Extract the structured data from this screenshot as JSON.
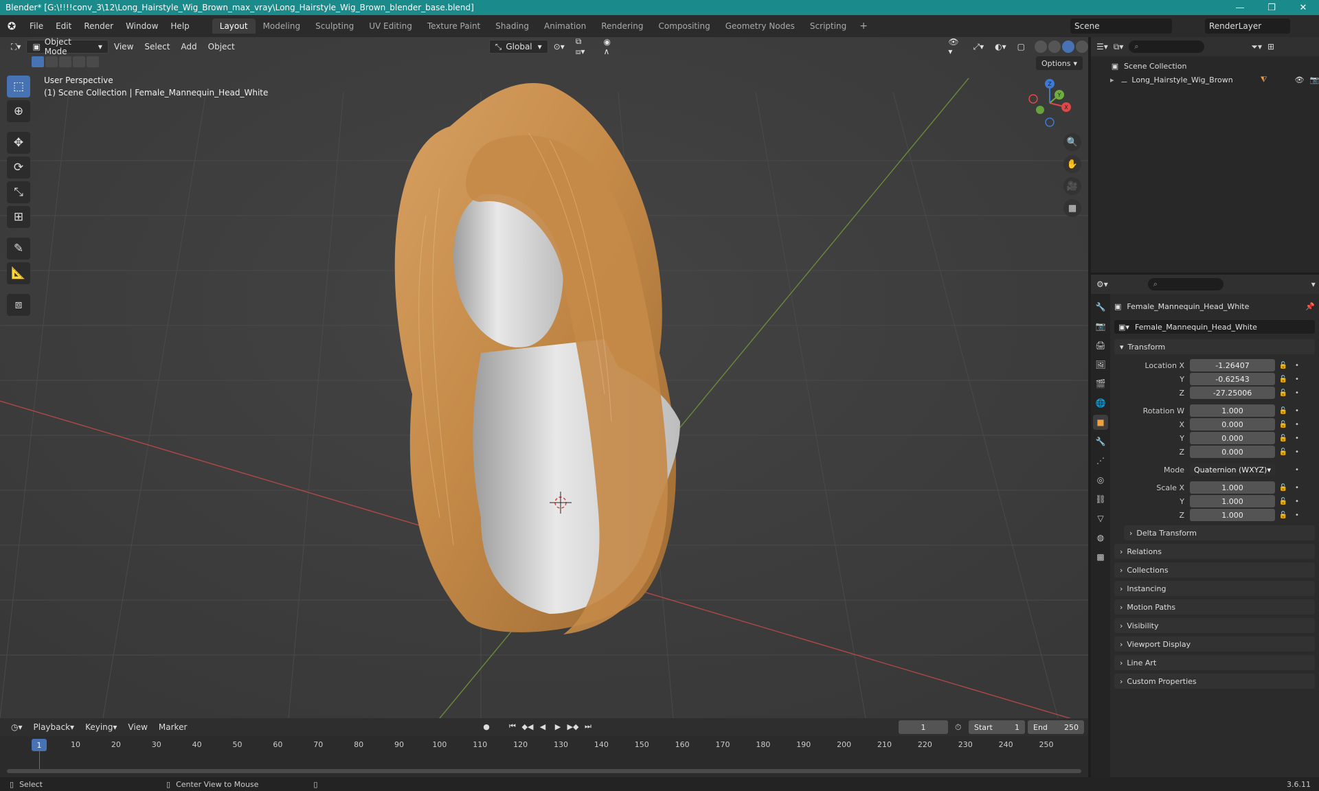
{
  "window": {
    "title": "Blender* [G:\\!!!!conv_3\\12\\Long_Hairstyle_Wig_Brown_max_vray\\Long_Hairstyle_Wig_Brown_blender_base.blend]",
    "minimize": "—",
    "maximize": "❐",
    "close": "✕"
  },
  "menubar": {
    "items": [
      "File",
      "Edit",
      "Render",
      "Window",
      "Help"
    ],
    "workspaces": [
      "Layout",
      "Modeling",
      "Sculpting",
      "UV Editing",
      "Texture Paint",
      "Shading",
      "Animation",
      "Rendering",
      "Compositing",
      "Geometry Nodes",
      "Scripting"
    ],
    "active_workspace": "Layout",
    "add_workspace": "+",
    "scene": "Scene",
    "view_layer": "RenderLayer"
  },
  "viewport": {
    "mode": "Object Mode",
    "menus": [
      "View",
      "Select",
      "Add",
      "Object"
    ],
    "transform_orientation": "Global",
    "options_label": "Options",
    "perspective_label": "User Perspective",
    "collection_label": "(1) Scene Collection | Female_Mannequin_Head_White",
    "gizmo_axes": [
      "X",
      "Y",
      "Z"
    ]
  },
  "outliner": {
    "search_placeholder": "",
    "root": "Scene Collection",
    "items": [
      {
        "label": "Long_Hairstyle_Wig_Brown"
      }
    ]
  },
  "properties": {
    "object_name": "Female_Mannequin_Head_White",
    "object_field": "Female_Mannequin_Head_White",
    "transform_title": "Transform",
    "location": {
      "label": "Location X",
      "x": "-1.26407",
      "y": "-0.62543",
      "z": "-27.25006"
    },
    "rotation": {
      "label": "Rotation W",
      "w": "1.000",
      "x": "0.000",
      "y": "0.000",
      "z": "0.000"
    },
    "mode": {
      "label": "Mode",
      "value": "Quaternion (WXYZ)"
    },
    "scale": {
      "label": "Scale X",
      "x": "1.000",
      "y": "1.000",
      "z": "1.000"
    },
    "axis_labels": {
      "x": "X",
      "y": "Y",
      "z": "Z"
    },
    "delta_transform": "Delta Transform",
    "panels": [
      "Relations",
      "Collections",
      "Instancing",
      "Motion Paths",
      "Visibility",
      "Viewport Display",
      "Line Art",
      "Custom Properties"
    ]
  },
  "timeline": {
    "menus": [
      "Playback",
      "Keying",
      "View",
      "Marker"
    ],
    "current_frame": "1",
    "start_label": "Start",
    "start": "1",
    "end_label": "End",
    "end": "250",
    "ticks": [
      "1",
      "10",
      "20",
      "30",
      "40",
      "50",
      "60",
      "70",
      "80",
      "90",
      "100",
      "110",
      "120",
      "130",
      "140",
      "150",
      "160",
      "170",
      "180",
      "190",
      "200",
      "210",
      "220",
      "230",
      "240",
      "250"
    ]
  },
  "statusbar": {
    "select": "Select",
    "center_view": "Center View to Mouse",
    "version": "3.6.11"
  }
}
